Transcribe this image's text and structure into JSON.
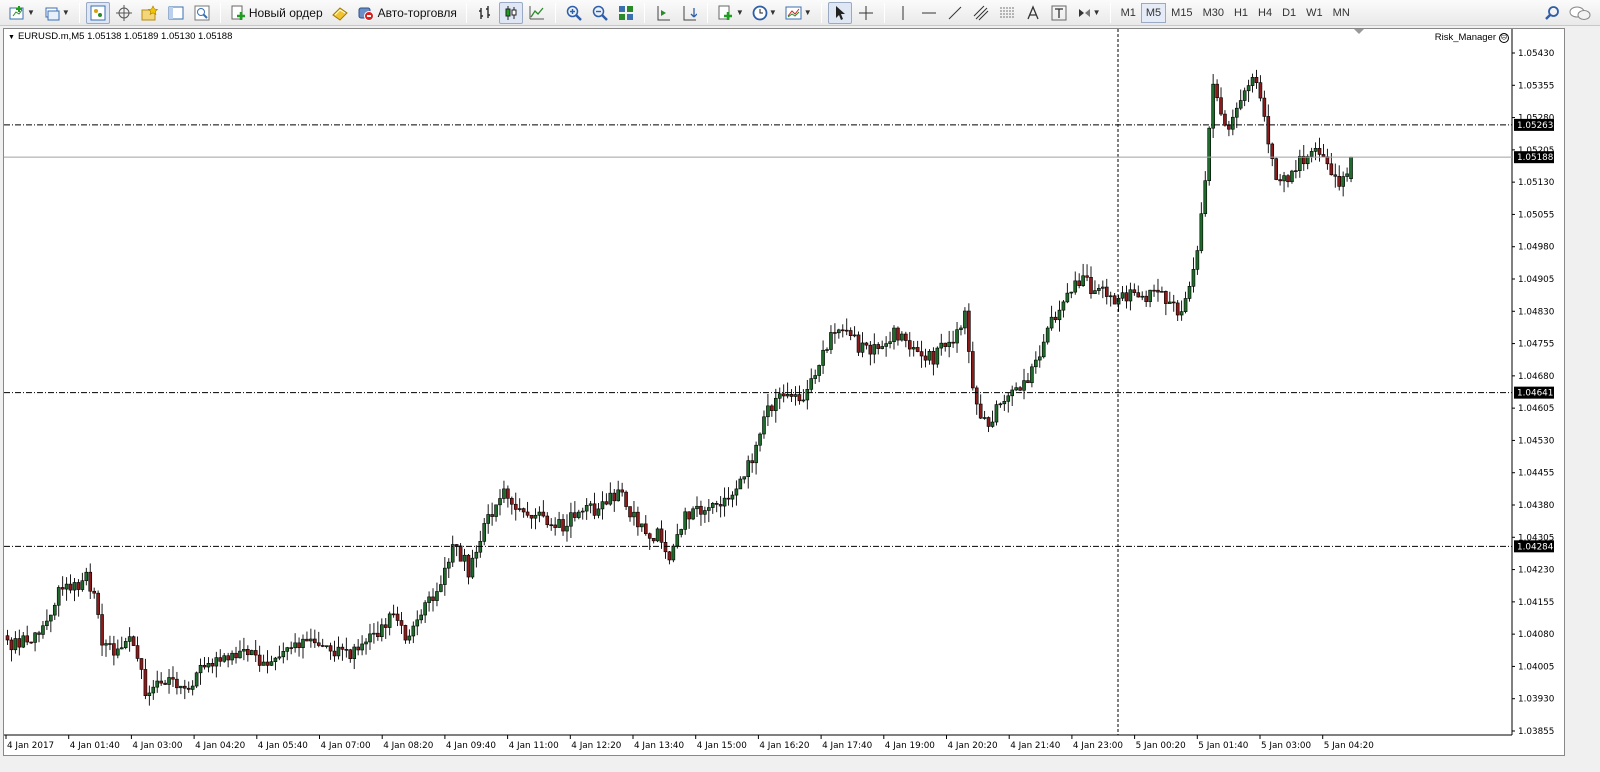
{
  "toolbar": {
    "new_order_label": "Новый ордер",
    "autotrading_label": "Авто-торговля",
    "timeframes": [
      "M1",
      "M5",
      "M15",
      "M30",
      "H1",
      "H4",
      "D1",
      "W1",
      "MN"
    ],
    "active_timeframe": "M5"
  },
  "chart": {
    "symbol_info": "EURUSD.m,M5  1.05138 1.05189 1.05130 1.05188",
    "expert_label": "Risk_Manager",
    "bull_color": "#1f6b2b",
    "bear_color": "#8b1a1a",
    "current_price_label": "1.05188",
    "hline_labels": [
      "1.05263",
      "1.04641",
      "1.04284"
    ]
  },
  "chart_data": {
    "type": "candlestick",
    "symbol": "EURUSD.m",
    "timeframe": "M5",
    "ohlc_last": {
      "open": 1.05138,
      "high": 1.05189,
      "low": 1.0513,
      "close": 1.05188
    },
    "price_ticks": [
      "1.05430",
      "1.05355",
      "1.05280",
      "1.05205",
      "1.05130",
      "1.05055",
      "1.04980",
      "1.04905",
      "1.04830",
      "1.04755",
      "1.04680",
      "1.04605",
      "1.04530",
      "1.04455",
      "1.04380",
      "1.04305",
      "1.04230",
      "1.04155",
      "1.04080",
      "1.04005",
      "1.03930",
      "1.03855"
    ],
    "ylim": [
      1.03855,
      1.0543
    ],
    "time_ticks": [
      "4 Jan 2017",
      "4 Jan 01:40",
      "4 Jan 03:00",
      "4 Jan 04:20",
      "4 Jan 05:40",
      "4 Jan 07:00",
      "4 Jan 08:20",
      "4 Jan 09:40",
      "4 Jan 11:00",
      "4 Jan 12:20",
      "4 Jan 13:40",
      "4 Jan 15:00",
      "4 Jan 16:20",
      "4 Jan 17:40",
      "4 Jan 19:00",
      "4 Jan 20:20",
      "4 Jan 21:40",
      "4 Jan 23:00",
      "5 Jan 00:20",
      "5 Jan 01:40",
      "5 Jan 03:00",
      "5 Jan 04:20"
    ],
    "horizontal_levels": [
      1.05263,
      1.04641,
      1.04284
    ],
    "current_price": 1.05188,
    "close_path": [
      [
        0,
        1.0405
      ],
      [
        8,
        1.0408
      ],
      [
        14,
        1.042
      ],
      [
        17,
        1.0419
      ],
      [
        20,
        1.0421
      ],
      [
        22,
        1.0418
      ],
      [
        24,
        1.0406
      ],
      [
        28,
        1.0403
      ],
      [
        32,
        1.0407
      ],
      [
        35,
        1.0394
      ],
      [
        40,
        1.0398
      ],
      [
        45,
        1.0396
      ],
      [
        50,
        1.04
      ],
      [
        55,
        1.0402
      ],
      [
        60,
        1.0404
      ],
      [
        65,
        1.0401
      ],
      [
        70,
        1.0405
      ],
      [
        75,
        1.0407
      ],
      [
        80,
        1.0406
      ],
      [
        85,
        1.0403
      ],
      [
        90,
        1.0405
      ],
      [
        94,
        1.0408
      ],
      [
        98,
        1.0412
      ],
      [
        102,
        1.0407
      ],
      [
        107,
        1.0416
      ],
      [
        110,
        1.0418
      ],
      [
        113,
        1.043
      ],
      [
        117,
        1.0423
      ],
      [
        121,
        1.0432
      ],
      [
        125,
        1.0441
      ],
      [
        130,
        1.0437
      ],
      [
        135,
        1.0435
      ],
      [
        140,
        1.0433
      ],
      [
        145,
        1.0436
      ],
      [
        150,
        1.0437
      ],
      [
        155,
        1.0441
      ],
      [
        158,
        1.0436
      ],
      [
        161,
        1.0432
      ],
      [
        165,
        1.0431
      ],
      [
        168,
        1.0426
      ],
      [
        172,
        1.0435
      ],
      [
        175,
        1.0437
      ],
      [
        178,
        1.0436
      ],
      [
        182,
        1.044
      ],
      [
        186,
        1.0444
      ],
      [
        189,
        1.0449
      ],
      [
        192,
        1.0459
      ],
      [
        195,
        1.0463
      ],
      [
        198,
        1.0463
      ],
      [
        202,
        1.0462
      ],
      [
        205,
        1.0468
      ],
      [
        208,
        1.0475
      ],
      [
        211,
        1.048
      ],
      [
        214,
        1.0479
      ],
      [
        216,
        1.0475
      ],
      [
        219,
        1.0474
      ],
      [
        223,
        1.0477
      ],
      [
        226,
        1.0478
      ],
      [
        229,
        1.0474
      ],
      [
        232,
        1.0473
      ],
      [
        235,
        1.0472
      ],
      [
        238,
        1.0475
      ],
      [
        241,
        1.0478
      ],
      [
        243,
        1.0482
      ],
      [
        245,
        1.0464
      ],
      [
        247,
        1.0458
      ],
      [
        249,
        1.0456
      ],
      [
        252,
        1.0462
      ],
      [
        255,
        1.0465
      ],
      [
        258,
        1.0466
      ],
      [
        261,
        1.047
      ],
      [
        264,
        1.0478
      ],
      [
        267,
        1.0484
      ],
      [
        270,
        1.0488
      ],
      [
        273,
        1.0491
      ],
      [
        275,
        1.0488
      ],
      [
        278,
        1.0487
      ],
      [
        281,
        1.0485
      ],
      [
        284,
        1.0487
      ],
      [
        287,
        1.0486
      ],
      [
        290,
        1.0487
      ],
      [
        293,
        1.0486
      ],
      [
        296,
        1.0485
      ],
      [
        298,
        1.0482
      ],
      [
        300,
        1.0488
      ],
      [
        302,
        1.0497
      ],
      [
        304,
        1.0515
      ],
      [
        306,
        1.0535
      ],
      [
        308,
        1.053
      ],
      [
        310,
        1.0524
      ],
      [
        313,
        1.0533
      ],
      [
        316,
        1.0537
      ],
      [
        318,
        1.0533
      ],
      [
        320,
        1.0523
      ],
      [
        322,
        1.0515
      ],
      [
        324,
        1.0513
      ],
      [
        327,
        1.0517
      ],
      [
        330,
        1.0518
      ],
      [
        332,
        1.0522
      ],
      [
        334,
        1.0518
      ],
      [
        336,
        1.0515
      ],
      [
        338,
        1.0513
      ],
      [
        340,
        1.0515
      ],
      [
        341,
        1.0518
      ]
    ]
  }
}
